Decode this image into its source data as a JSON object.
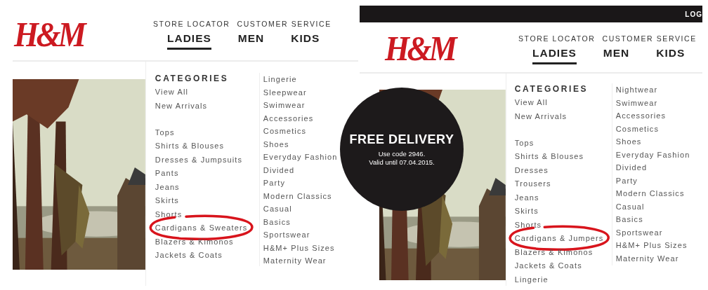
{
  "panels": [
    {
      "logo": "H&M",
      "utility_links": [
        "STORE LOCATOR",
        "CUSTOMER SERVICE"
      ],
      "nav": [
        {
          "label": "LADIES",
          "selected": true
        },
        {
          "label": "MEN",
          "selected": false
        },
        {
          "label": "KIDS",
          "selected": false
        }
      ],
      "menu": {
        "heading": "CATEGORIES",
        "column_1": [
          [
            {
              "label": "View All",
              "circled": false
            },
            {
              "label": "New Arrivals",
              "circled": false
            }
          ],
          [
            {
              "label": "Tops",
              "circled": false
            },
            {
              "label": "Shirts & Blouses",
              "circled": false
            },
            {
              "label": "Dresses & Jumpsuits",
              "circled": false
            },
            {
              "label": "Pants",
              "circled": false
            },
            {
              "label": "Jeans",
              "circled": false
            },
            {
              "label": "Skirts",
              "circled": false
            },
            {
              "label": "Shorts",
              "circled": false
            },
            {
              "label": "Cardigans & Sweaters",
              "circled": true
            },
            {
              "label": "Blazers & Kimonos",
              "circled": false
            },
            {
              "label": "Jackets & Coats",
              "circled": false
            }
          ]
        ],
        "column_2": [
          "Lingerie",
          "Sleepwear",
          "Swimwear",
          "Accessories",
          "Cosmetics",
          "Shoes",
          "Everyday Fashion",
          "Divided",
          "Party",
          "Modern Classics",
          "Casual",
          "Basics",
          "Sportswear",
          "H&M+ Plus Sizes",
          "Maternity Wear"
        ]
      }
    },
    {
      "top_bar": {
        "link": "LOG"
      },
      "logo": "H&M",
      "utility_links": [
        "STORE LOCATOR",
        "CUSTOMER SERVICE"
      ],
      "nav": [
        {
          "label": "LADIES",
          "selected": true
        },
        {
          "label": "MEN",
          "selected": false
        },
        {
          "label": "KIDS",
          "selected": false
        }
      ],
      "promo": {
        "title": "FREE DELIVERY",
        "lines": [
          "Use code 2946.",
          "Valid until 07.04.2015."
        ]
      },
      "menu": {
        "heading": "CATEGORIES",
        "column_1": [
          [
            {
              "label": "View All",
              "circled": false
            },
            {
              "label": "New Arrivals",
              "circled": false
            }
          ],
          [
            {
              "label": "Tops",
              "circled": false
            },
            {
              "label": "Shirts & Blouses",
              "circled": false
            },
            {
              "label": "Dresses",
              "circled": false
            },
            {
              "label": "Trousers",
              "circled": false
            },
            {
              "label": "Jeans",
              "circled": false
            },
            {
              "label": "Skirts",
              "circled": false
            },
            {
              "label": "Shorts",
              "circled": false
            },
            {
              "label": "Cardigans & Jumpers",
              "circled": true
            },
            {
              "label": "Blazers & Kimonos",
              "circled": false
            },
            {
              "label": "Jackets & Coats",
              "circled": false
            },
            {
              "label": "Lingerie",
              "circled": false
            }
          ]
        ],
        "column_2": [
          "Nightwear",
          "Swimwear",
          "Accessories",
          "Cosmetics",
          "Shoes",
          "Everyday Fashion",
          "Divided",
          "Party",
          "Modern Classics",
          "Casual",
          "Basics",
          "Sportswear",
          "H&M+ Plus Sizes",
          "Maternity Wear"
        ]
      }
    }
  ]
}
